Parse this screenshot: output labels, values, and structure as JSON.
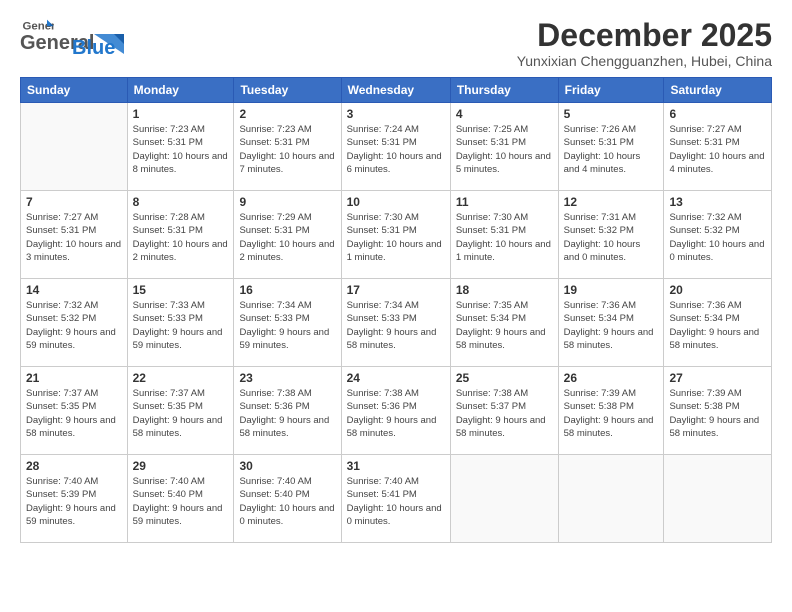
{
  "header": {
    "logo_general": "General",
    "logo_blue": "Blue",
    "month": "December 2025",
    "location": "Yunxixian Chengguanzhen, Hubei, China"
  },
  "days_of_week": [
    "Sunday",
    "Monday",
    "Tuesday",
    "Wednesday",
    "Thursday",
    "Friday",
    "Saturday"
  ],
  "weeks": [
    [
      {
        "day": "",
        "sunrise": "",
        "sunset": "",
        "daylight": ""
      },
      {
        "day": "1",
        "sunrise": "Sunrise: 7:23 AM",
        "sunset": "Sunset: 5:31 PM",
        "daylight": "Daylight: 10 hours and 8 minutes."
      },
      {
        "day": "2",
        "sunrise": "Sunrise: 7:23 AM",
        "sunset": "Sunset: 5:31 PM",
        "daylight": "Daylight: 10 hours and 7 minutes."
      },
      {
        "day": "3",
        "sunrise": "Sunrise: 7:24 AM",
        "sunset": "Sunset: 5:31 PM",
        "daylight": "Daylight: 10 hours and 6 minutes."
      },
      {
        "day": "4",
        "sunrise": "Sunrise: 7:25 AM",
        "sunset": "Sunset: 5:31 PM",
        "daylight": "Daylight: 10 hours and 5 minutes."
      },
      {
        "day": "5",
        "sunrise": "Sunrise: 7:26 AM",
        "sunset": "Sunset: 5:31 PM",
        "daylight": "Daylight: 10 hours and 4 minutes."
      },
      {
        "day": "6",
        "sunrise": "Sunrise: 7:27 AM",
        "sunset": "Sunset: 5:31 PM",
        "daylight": "Daylight: 10 hours and 4 minutes."
      }
    ],
    [
      {
        "day": "7",
        "sunrise": "Sunrise: 7:27 AM",
        "sunset": "Sunset: 5:31 PM",
        "daylight": "Daylight: 10 hours and 3 minutes."
      },
      {
        "day": "8",
        "sunrise": "Sunrise: 7:28 AM",
        "sunset": "Sunset: 5:31 PM",
        "daylight": "Daylight: 10 hours and 2 minutes."
      },
      {
        "day": "9",
        "sunrise": "Sunrise: 7:29 AM",
        "sunset": "Sunset: 5:31 PM",
        "daylight": "Daylight: 10 hours and 2 minutes."
      },
      {
        "day": "10",
        "sunrise": "Sunrise: 7:30 AM",
        "sunset": "Sunset: 5:31 PM",
        "daylight": "Daylight: 10 hours and 1 minute."
      },
      {
        "day": "11",
        "sunrise": "Sunrise: 7:30 AM",
        "sunset": "Sunset: 5:31 PM",
        "daylight": "Daylight: 10 hours and 1 minute."
      },
      {
        "day": "12",
        "sunrise": "Sunrise: 7:31 AM",
        "sunset": "Sunset: 5:32 PM",
        "daylight": "Daylight: 10 hours and 0 minutes."
      },
      {
        "day": "13",
        "sunrise": "Sunrise: 7:32 AM",
        "sunset": "Sunset: 5:32 PM",
        "daylight": "Daylight: 10 hours and 0 minutes."
      }
    ],
    [
      {
        "day": "14",
        "sunrise": "Sunrise: 7:32 AM",
        "sunset": "Sunset: 5:32 PM",
        "daylight": "Daylight: 9 hours and 59 minutes."
      },
      {
        "day": "15",
        "sunrise": "Sunrise: 7:33 AM",
        "sunset": "Sunset: 5:33 PM",
        "daylight": "Daylight: 9 hours and 59 minutes."
      },
      {
        "day": "16",
        "sunrise": "Sunrise: 7:34 AM",
        "sunset": "Sunset: 5:33 PM",
        "daylight": "Daylight: 9 hours and 59 minutes."
      },
      {
        "day": "17",
        "sunrise": "Sunrise: 7:34 AM",
        "sunset": "Sunset: 5:33 PM",
        "daylight": "Daylight: 9 hours and 58 minutes."
      },
      {
        "day": "18",
        "sunrise": "Sunrise: 7:35 AM",
        "sunset": "Sunset: 5:34 PM",
        "daylight": "Daylight: 9 hours and 58 minutes."
      },
      {
        "day": "19",
        "sunrise": "Sunrise: 7:36 AM",
        "sunset": "Sunset: 5:34 PM",
        "daylight": "Daylight: 9 hours and 58 minutes."
      },
      {
        "day": "20",
        "sunrise": "Sunrise: 7:36 AM",
        "sunset": "Sunset: 5:34 PM",
        "daylight": "Daylight: 9 hours and 58 minutes."
      }
    ],
    [
      {
        "day": "21",
        "sunrise": "Sunrise: 7:37 AM",
        "sunset": "Sunset: 5:35 PM",
        "daylight": "Daylight: 9 hours and 58 minutes."
      },
      {
        "day": "22",
        "sunrise": "Sunrise: 7:37 AM",
        "sunset": "Sunset: 5:35 PM",
        "daylight": "Daylight: 9 hours and 58 minutes."
      },
      {
        "day": "23",
        "sunrise": "Sunrise: 7:38 AM",
        "sunset": "Sunset: 5:36 PM",
        "daylight": "Daylight: 9 hours and 58 minutes."
      },
      {
        "day": "24",
        "sunrise": "Sunrise: 7:38 AM",
        "sunset": "Sunset: 5:36 PM",
        "daylight": "Daylight: 9 hours and 58 minutes."
      },
      {
        "day": "25",
        "sunrise": "Sunrise: 7:38 AM",
        "sunset": "Sunset: 5:37 PM",
        "daylight": "Daylight: 9 hours and 58 minutes."
      },
      {
        "day": "26",
        "sunrise": "Sunrise: 7:39 AM",
        "sunset": "Sunset: 5:38 PM",
        "daylight": "Daylight: 9 hours and 58 minutes."
      },
      {
        "day": "27",
        "sunrise": "Sunrise: 7:39 AM",
        "sunset": "Sunset: 5:38 PM",
        "daylight": "Daylight: 9 hours and 58 minutes."
      }
    ],
    [
      {
        "day": "28",
        "sunrise": "Sunrise: 7:40 AM",
        "sunset": "Sunset: 5:39 PM",
        "daylight": "Daylight: 9 hours and 59 minutes."
      },
      {
        "day": "29",
        "sunrise": "Sunrise: 7:40 AM",
        "sunset": "Sunset: 5:40 PM",
        "daylight": "Daylight: 9 hours and 59 minutes."
      },
      {
        "day": "30",
        "sunrise": "Sunrise: 7:40 AM",
        "sunset": "Sunset: 5:40 PM",
        "daylight": "Daylight: 10 hours and 0 minutes."
      },
      {
        "day": "31",
        "sunrise": "Sunrise: 7:40 AM",
        "sunset": "Sunset: 5:41 PM",
        "daylight": "Daylight: 10 hours and 0 minutes."
      },
      {
        "day": "",
        "sunrise": "",
        "sunset": "",
        "daylight": ""
      },
      {
        "day": "",
        "sunrise": "",
        "sunset": "",
        "daylight": ""
      },
      {
        "day": "",
        "sunrise": "",
        "sunset": "",
        "daylight": ""
      }
    ]
  ]
}
